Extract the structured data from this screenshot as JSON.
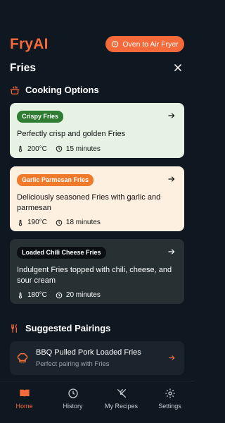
{
  "header": {
    "brand": "FryAI",
    "oven_button": "Oven to Air Fryer"
  },
  "page": {
    "title": "Fries"
  },
  "cooking": {
    "section_title": "Cooking Options",
    "options": [
      {
        "badge": "Crispy Fries",
        "description": "Perfectly crisp and golden Fries",
        "temperature": "200°C",
        "time": "15 minutes"
      },
      {
        "badge": "Garlic Parmesan Fries",
        "description": "Deliciously seasoned Fries with garlic and parmesan",
        "temperature": "190°C",
        "time": "18 minutes"
      },
      {
        "badge": "Loaded Chili Cheese Fries",
        "description": "Indulgent Fries topped with chili, cheese, and sour cream",
        "temperature": "180°C",
        "time": "20 minutes"
      }
    ]
  },
  "pairings": {
    "section_title": "Suggested Pairings",
    "items": [
      {
        "title": "BBQ Pulled Pork Loaded Fries",
        "subtitle": "Perfect pairing with Fries"
      }
    ]
  },
  "nav": {
    "items": [
      {
        "label": "Home",
        "icon": "book-icon",
        "active": true
      },
      {
        "label": "History",
        "icon": "clock-icon",
        "active": false
      },
      {
        "label": "My Recipes",
        "icon": "utensils-icon",
        "active": false
      },
      {
        "label": "Settings",
        "icon": "gear-icon",
        "active": false
      }
    ]
  },
  "colors": {
    "accent": "#f56a3a",
    "background": "#0f1720",
    "crispy_badge": "#2e7d32",
    "garlic_badge": "#f07a2c",
    "chili_badge": "#0b0f12"
  }
}
